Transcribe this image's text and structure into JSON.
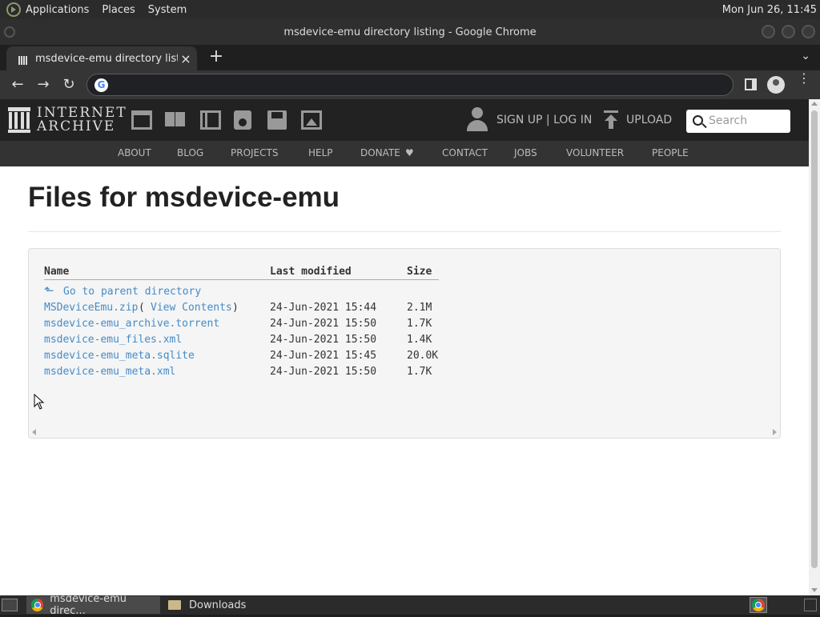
{
  "desktop": {
    "menus": [
      "Applications",
      "Places",
      "System"
    ],
    "clock": "Mon Jun 26, 11:45"
  },
  "window": {
    "title": "msdevice-emu directory listing - Google Chrome"
  },
  "browser": {
    "tab_title": "msdevice-emu directory listing",
    "tab_close": "×",
    "new_tab": "+",
    "omnibox_value": "",
    "omnibox_icon": "G"
  },
  "site": {
    "logo_line1": "INTERNET",
    "logo_line2": "ARCHIVE",
    "signup": "SIGN UP | LOG IN",
    "upload": "UPLOAD",
    "search_placeholder": "Search",
    "nav": [
      "ABOUT",
      "BLOG",
      "PROJECTS",
      "HELP",
      "DONATE",
      "CONTACT",
      "JOBS",
      "VOLUNTEER",
      "PEOPLE"
    ],
    "donate_heart": "♥"
  },
  "page": {
    "heading": "Files for msdevice-emu",
    "columns": [
      "Name",
      "Last modified",
      "Size"
    ],
    "parent_link": "Go to parent directory",
    "files": [
      {
        "name": "MSDeviceEmu.zip",
        "extra_open": " (",
        "extra_link": "View Contents",
        "extra_close": ")",
        "modified": "24-Jun-2021 15:44",
        "size": "2.1M"
      },
      {
        "name": "msdevice-emu_archive.torrent",
        "modified": "24-Jun-2021 15:50",
        "size": "1.7K"
      },
      {
        "name": "msdevice-emu_files.xml",
        "modified": "24-Jun-2021 15:50",
        "size": "1.4K"
      },
      {
        "name": "msdevice-emu_meta.sqlite",
        "modified": "24-Jun-2021 15:45",
        "size": "20.0K"
      },
      {
        "name": "msdevice-emu_meta.xml",
        "modified": "24-Jun-2021 15:50",
        "size": "1.7K"
      }
    ]
  },
  "taskbar": {
    "items": [
      "msdevice-emu direc...",
      "Downloads"
    ]
  },
  "colors": {
    "link": "#428bca",
    "ia_header": "#222222",
    "ia_nav": "#333333"
  }
}
